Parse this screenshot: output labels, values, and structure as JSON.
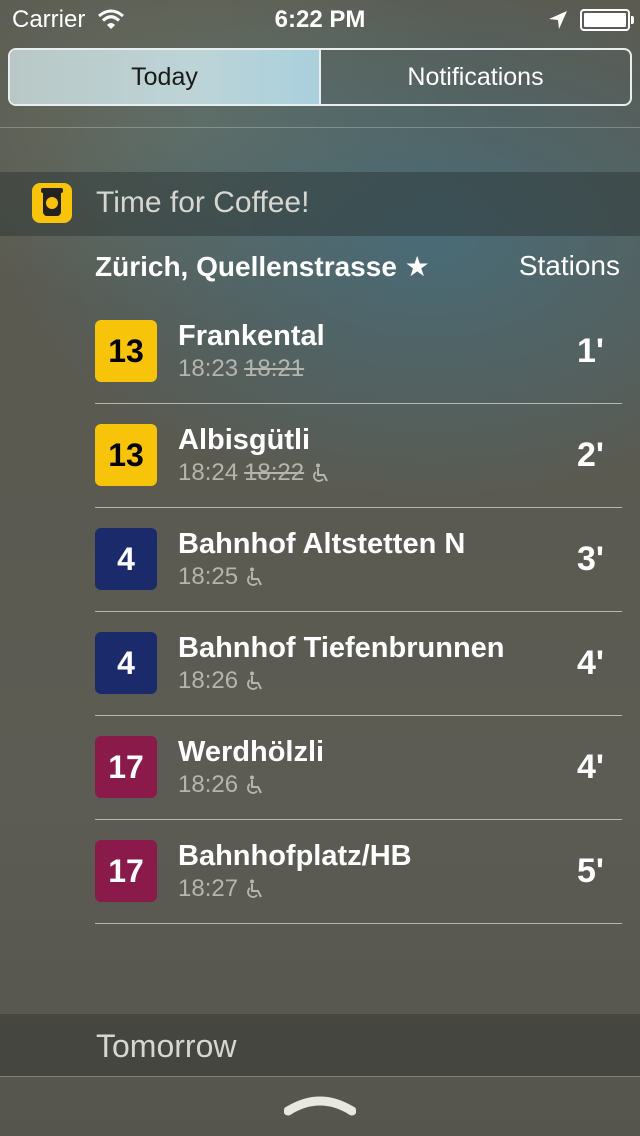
{
  "status_bar": {
    "carrier": "Carrier",
    "time": "6:22 PM"
  },
  "tabs": {
    "today": "Today",
    "notifications": "Notifications"
  },
  "widget": {
    "title": "Time for Coffee!",
    "icon": "coffee-cup-icon",
    "accent": "#f7c40a"
  },
  "station": {
    "name": "Zürich, Quellenstrasse ★",
    "stations_link": "Stations"
  },
  "departures": [
    {
      "line": "13",
      "line_color": "#f7c40a",
      "line_text_color": "#000000",
      "destination": "Frankental",
      "time": "18:23",
      "scheduled": "18:21",
      "accessible": false,
      "minutes": "1'"
    },
    {
      "line": "13",
      "line_color": "#f7c40a",
      "line_text_color": "#000000",
      "destination": "Albisgütli",
      "time": "18:24",
      "scheduled": "18:22",
      "accessible": true,
      "minutes": "2'"
    },
    {
      "line": "4",
      "line_color": "#1b2a6b",
      "line_text_color": "#ffffff",
      "destination": "Bahnhof Altstetten N",
      "time": "18:25",
      "scheduled": "",
      "accessible": true,
      "minutes": "3'"
    },
    {
      "line": "4",
      "line_color": "#1b2a6b",
      "line_text_color": "#ffffff",
      "destination": "Bahnhof Tiefenbrunnen",
      "time": "18:26",
      "scheduled": "",
      "accessible": true,
      "minutes": "4'"
    },
    {
      "line": "17",
      "line_color": "#8a1a4a",
      "line_text_color": "#ffffff",
      "destination": "Werdhölzli",
      "time": "18:26",
      "scheduled": "",
      "accessible": true,
      "minutes": "4'"
    },
    {
      "line": "17",
      "line_color": "#8a1a4a",
      "line_text_color": "#ffffff",
      "destination": "Bahnhofplatz/HB",
      "time": "18:27",
      "scheduled": "",
      "accessible": true,
      "minutes": "5'"
    }
  ],
  "tomorrow": {
    "label": "Tomorrow"
  }
}
